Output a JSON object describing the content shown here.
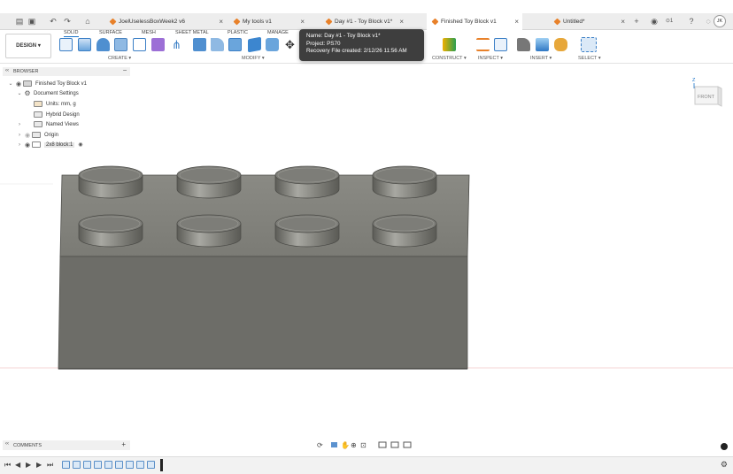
{
  "tabs": [
    {
      "label": "JoelUselessBoxWeek2 v6",
      "active": false
    },
    {
      "label": "My tools v1",
      "active": false
    },
    {
      "label": "Day #1 - Toy Block v1*",
      "active": false
    },
    {
      "label": "Finished Toy Block v1",
      "active": true
    },
    {
      "label": "Untitled*",
      "active": false
    }
  ],
  "notifications": "1",
  "user_initials": "JK",
  "workspace": "DESIGN",
  "ribbon_tabs": [
    "SOLID",
    "SURFACE",
    "MESH",
    "SHEET METAL",
    "PLASTIC",
    "MANAGE"
  ],
  "groups": {
    "create": "CREATE",
    "modify": "MODIFY",
    "construct": "CONSTRUCT",
    "inspect": "INSPECT",
    "insert": "INSERT",
    "select": "SELECT"
  },
  "tooltip": {
    "name": "Name: Day #1 - Toy Block v1*",
    "project": "Project: PS70",
    "recovery": "Recovery File created: 2/12/26 11:56 AM"
  },
  "browser": {
    "title": "BROWSER",
    "root": "Finished Toy Block v1",
    "doc_settings": "Document Settings",
    "units": "Units: mm, g",
    "design_type": "Hybrid Design",
    "named_views": "Named Views",
    "origin": "Origin",
    "component": "2x8 block:1"
  },
  "viewcube": {
    "face": "FRONT",
    "axis": "Z"
  },
  "comments": {
    "title": "COMMENTS"
  },
  "colors": {
    "accent": "#1a73c9",
    "brand_tab": "#e8812a",
    "model_body": "#6d6d68",
    "tooltip_bg": "#3e3e3e"
  }
}
